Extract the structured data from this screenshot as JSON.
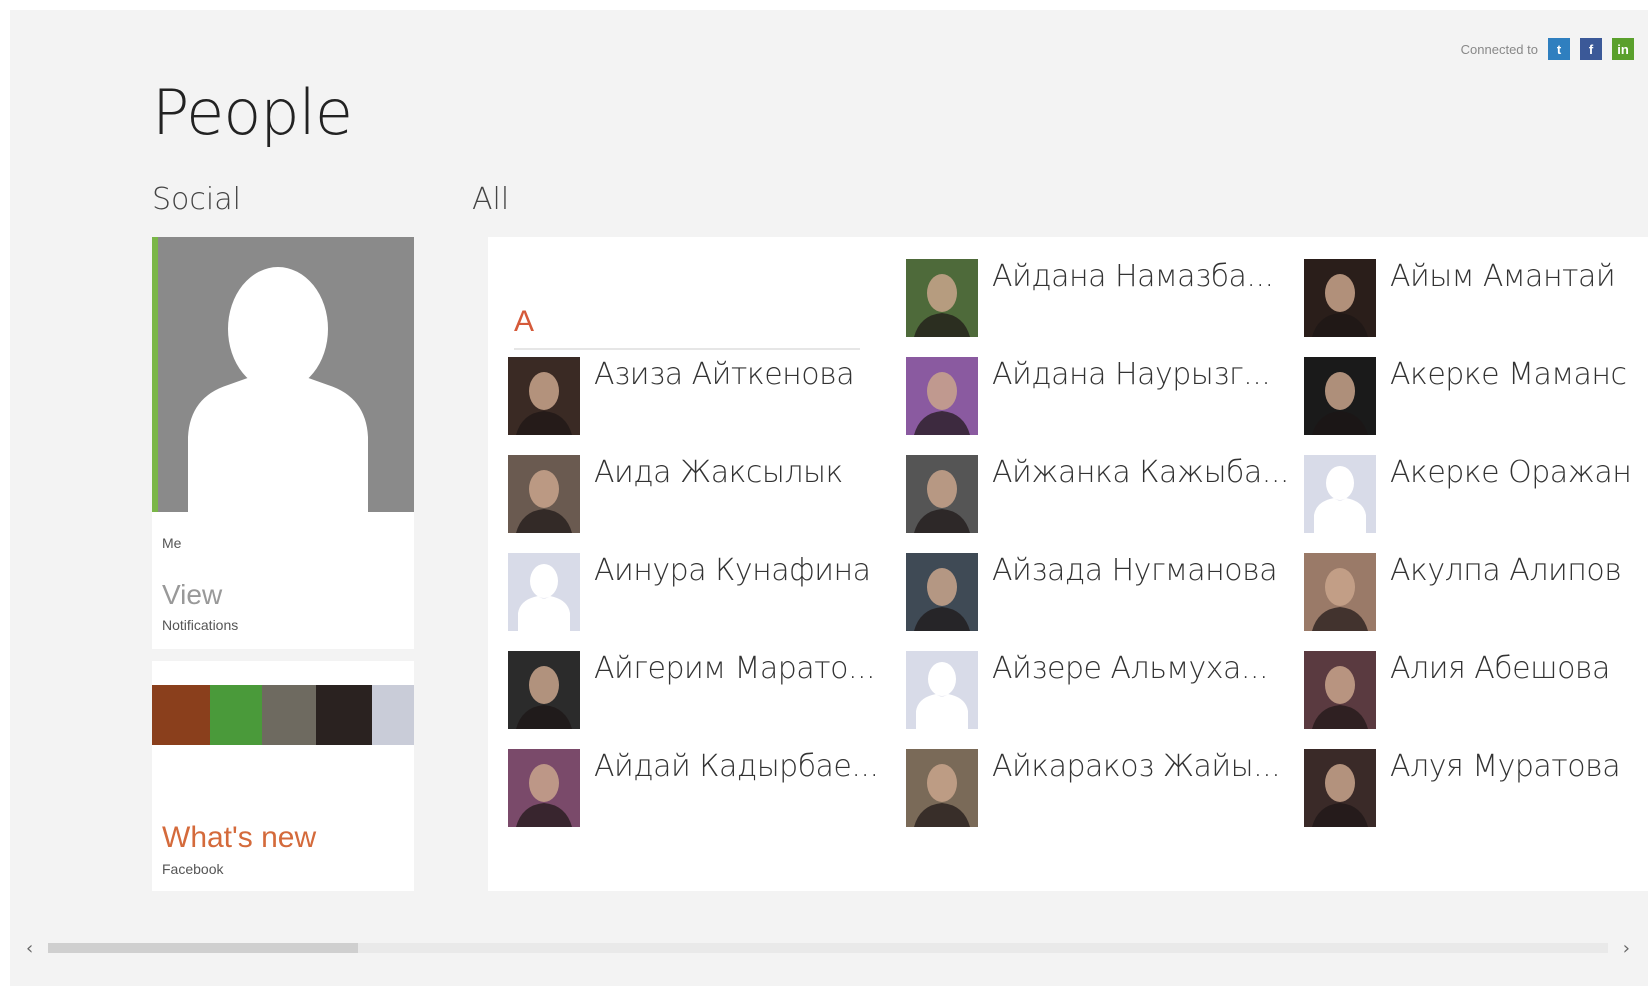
{
  "connected": {
    "label": "Connected to",
    "services": [
      "twitter-icon",
      "facebook-icon",
      "linkedin-icon"
    ]
  },
  "page_title": "People",
  "social": {
    "heading": "Social",
    "me_tile": {
      "label": "Me",
      "action": "View",
      "sub": "Notifications"
    },
    "whats_new": {
      "title": "What's new",
      "sub": "Facebook"
    }
  },
  "all": {
    "heading": "All",
    "letter": "A",
    "contacts": [
      {
        "name": "Азиза Айткенова",
        "avatar": "photo"
      },
      {
        "name": "Аида Жаксылык",
        "avatar": "photo"
      },
      {
        "name": "Аинура Кунафина",
        "avatar": "placeholder"
      },
      {
        "name": "Айгерим Марато...",
        "avatar": "photo"
      },
      {
        "name": "Айдай Кадырбае...",
        "avatar": "photo"
      },
      {
        "name": "Айдана Намазба...",
        "avatar": "photo"
      },
      {
        "name": "Айдана Наурызг...",
        "avatar": "photo"
      },
      {
        "name": "Айжанка Кажыба...",
        "avatar": "photo"
      },
      {
        "name": "Айзада Нугманова",
        "avatar": "photo"
      },
      {
        "name": "Айзере Альмуха...",
        "avatar": "placeholder"
      },
      {
        "name": "Айкаракоз Жайы...",
        "avatar": "photo"
      },
      {
        "name": "Айым Амантай",
        "avatar": "photo"
      },
      {
        "name": "Акерке Маманс",
        "avatar": "photo"
      },
      {
        "name": "Акерке Оражан",
        "avatar": "placeholder"
      },
      {
        "name": "Акулпа Алипов",
        "avatar": "photo"
      },
      {
        "name": "Алия Абешова",
        "avatar": "photo"
      },
      {
        "name": "Алуя Муратова",
        "avatar": "photo"
      }
    ]
  },
  "colors": {
    "accent_green": "#7ab648",
    "letter_orange": "#d55a3a",
    "whats_new_orange": "#d46a3b",
    "background": "#f3f3f3"
  },
  "scroll": {
    "left_arrow": "‹",
    "right_arrow": "›"
  }
}
